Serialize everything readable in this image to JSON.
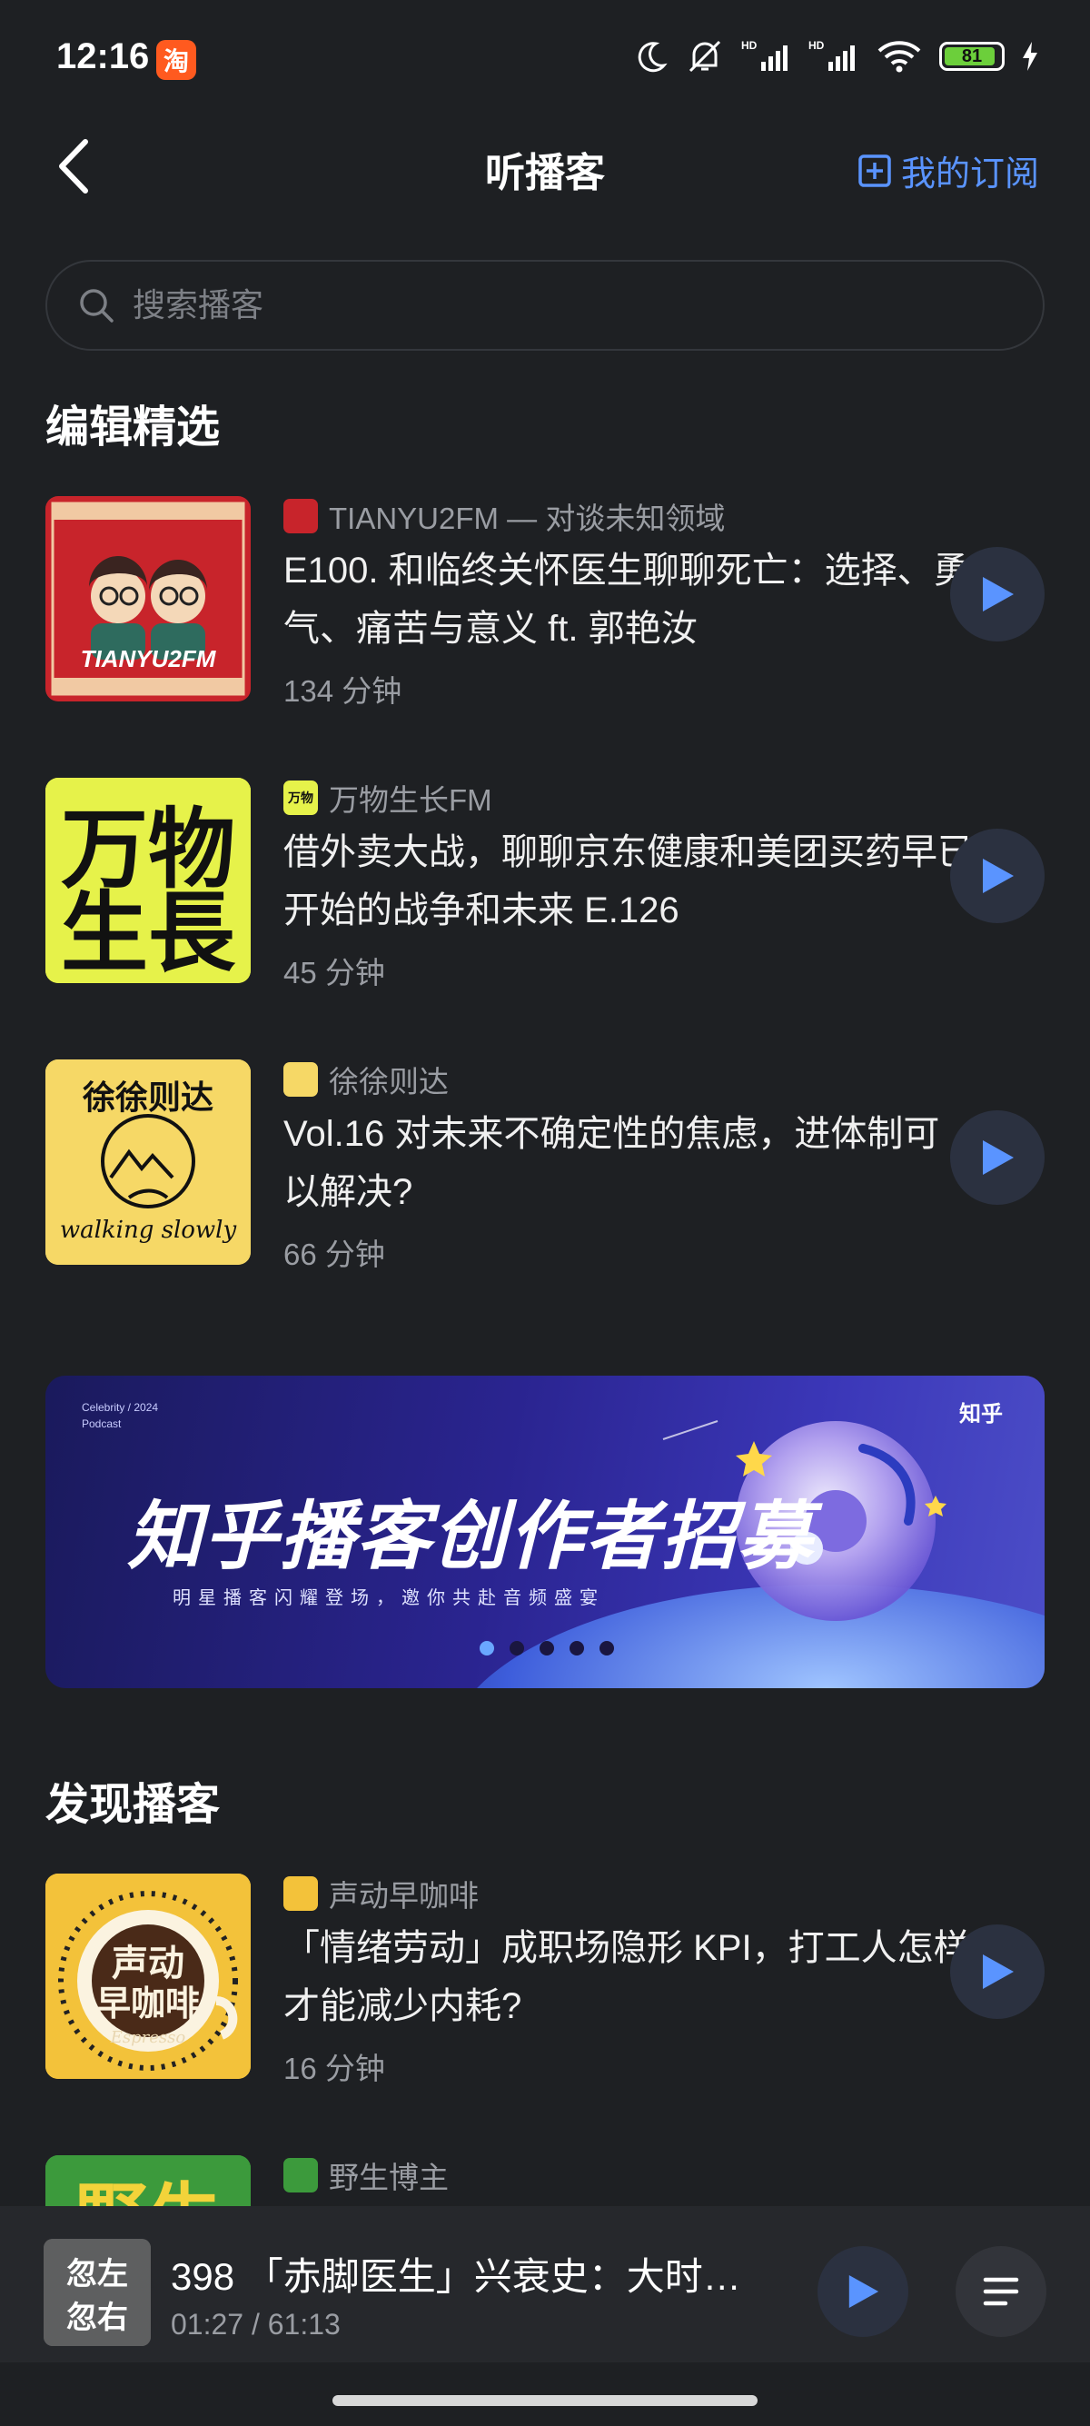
{
  "status_bar": {
    "time": "12:16",
    "app_badge": "淘",
    "battery": "81"
  },
  "header": {
    "title": "听播客",
    "subscriptions_label": "我的订阅"
  },
  "search": {
    "placeholder": "搜索播客"
  },
  "editor_picks": {
    "title": "编辑精选",
    "items": [
      {
        "source": "TIANYU2FM — 对谈未知领域",
        "title": "E100. 和临终关怀医生聊聊死亡：选择、勇气、痛苦与意义 ft. 郭艳汝",
        "duration": "134 分钟",
        "cover_text": "TIANYU2FM"
      },
      {
        "source": "万物生长FM",
        "title": "借外卖大战，聊聊京东健康和美团买药早已开始的战争和未来 E.126",
        "duration": "45 分钟",
        "cover_text": "万物生長"
      },
      {
        "source": "徐徐则达",
        "title": "Vol.16 对未来不确定性的焦虑，进体制可以解决?",
        "duration": "66 分钟",
        "cover_text_top": "徐徐则达",
        "cover_text_bottom": "walking slowly"
      }
    ]
  },
  "banner": {
    "headline": "知乎播客创作者招募",
    "subline": "明星播客闪耀登场，邀你共赴音频盛宴",
    "tag_left": "Celebrity / 2024",
    "tag_left2": "Podcast",
    "brand": "知乎",
    "active_slide": 1,
    "slide_count": 5
  },
  "discover": {
    "title": "发现播客",
    "items": [
      {
        "source": "声动早咖啡",
        "title": "「情绪劳动」成职场隐形 KPI，打工人怎样才能减少内耗?",
        "duration": "16 分钟",
        "cover_text": "声动早咖啡",
        "cover_sub": "Espresso"
      },
      {
        "source": "野生博主",
        "title": "",
        "duration": "",
        "cover_text": "野生"
      }
    ]
  },
  "now_playing": {
    "title": "398 「赤脚医生」兴衰史：大时…",
    "time": "01:27 / 61:13",
    "cover_text": "忽左忽右"
  },
  "colors": {
    "accent": "#5a94ff",
    "background": "#1e2023"
  }
}
